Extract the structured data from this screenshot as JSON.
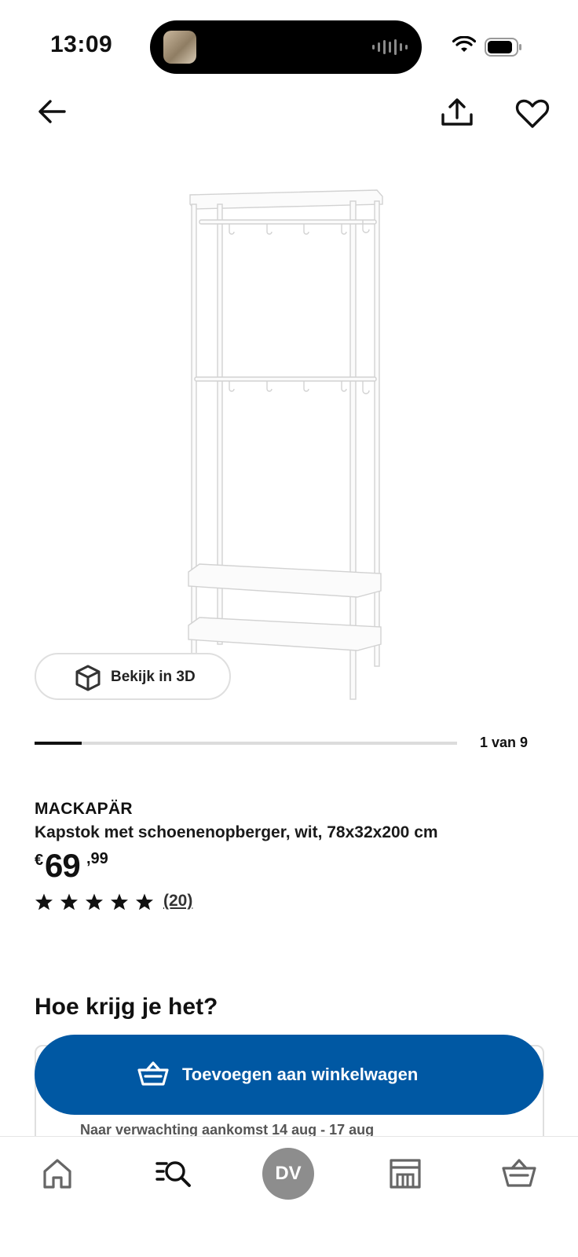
{
  "status_bar": {
    "time": "13:09"
  },
  "product": {
    "brand": "MACKAPÄR",
    "description": "Kapstok met schoenenopberger, wit, 78x32x200 cm",
    "price": {
      "currency": "€",
      "integer": "69",
      "decimal": ",99"
    },
    "rating": {
      "stars": 5,
      "review_count": "(20)"
    }
  },
  "gallery": {
    "view_3d_label": "Bekijk in 3D",
    "position_label": "1 van 9",
    "current": 1,
    "total": 9
  },
  "delivery": {
    "section_title": "Hoe krijg je het?",
    "add_to_cart_label": "Toevoegen aan winkelwagen",
    "arrival_text": "Naar verwachting aankomst 14 aug - 17 aug"
  },
  "tabbar": {
    "items": [
      {
        "icon": "home-icon"
      },
      {
        "icon": "search-list-icon"
      },
      {
        "icon": "avatar",
        "label": "DV"
      },
      {
        "icon": "store-icon"
      },
      {
        "icon": "cart-icon"
      }
    ]
  },
  "colors": {
    "primary_blue": "#0058a3",
    "avatar_gray": "#8d8d8d"
  }
}
